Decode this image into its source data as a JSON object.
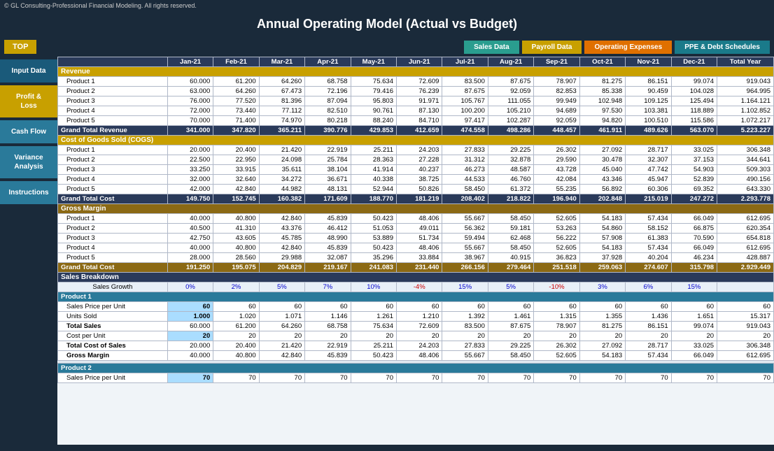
{
  "app": {
    "copyright": "© GL Consulting-Professional Financial Modeling. All rights reserved.",
    "title": "Annual Operating Model (Actual vs Budget)"
  },
  "nav": {
    "top_btn": "TOP",
    "buttons": [
      "Sales Data",
      "Payroll Data",
      "Operating Expenses",
      "PPE & Debt Schedules"
    ]
  },
  "sidebar": {
    "items": [
      {
        "label": "Input Data"
      },
      {
        "label": "Profit & Loss"
      },
      {
        "label": "Cash Flow"
      },
      {
        "label": "Variance Analysis"
      },
      {
        "label": "Instructions"
      }
    ]
  },
  "table": {
    "columns": [
      "",
      "Jan-21",
      "Feb-21",
      "Mar-21",
      "Apr-21",
      "May-21",
      "Jun-21",
      "Jul-21",
      "Aug-21",
      "Sep-21",
      "Oct-21",
      "Nov-21",
      "Dec-21",
      "Total Year"
    ],
    "revenue": {
      "header": "Revenue",
      "rows": [
        [
          "Product 1",
          "60.000",
          "61.200",
          "64.260",
          "68.758",
          "75.634",
          "72.609",
          "83.500",
          "87.675",
          "78.907",
          "81.275",
          "86.151",
          "99.074",
          "919.043"
        ],
        [
          "Product 2",
          "63.000",
          "64.260",
          "67.473",
          "72.196",
          "79.416",
          "76.239",
          "87.675",
          "92.059",
          "82.853",
          "85.338",
          "90.459",
          "104.028",
          "964.995"
        ],
        [
          "Product 3",
          "76.000",
          "77.520",
          "81.396",
          "87.094",
          "95.803",
          "91.971",
          "105.767",
          "111.055",
          "99.949",
          "102.948",
          "109.125",
          "125.494",
          "1.164.121"
        ],
        [
          "Product 4",
          "72.000",
          "73.440",
          "77.112",
          "82.510",
          "90.761",
          "87.130",
          "100.200",
          "105.210",
          "94.689",
          "97.530",
          "103.381",
          "118.889",
          "1.102.852"
        ],
        [
          "Product 5",
          "70.000",
          "71.400",
          "74.970",
          "80.218",
          "88.240",
          "84.710",
          "97.417",
          "102.287",
          "92.059",
          "94.820",
          "100.510",
          "115.586",
          "1.072.217"
        ]
      ],
      "total": [
        "Grand Total Revenue",
        "341.000",
        "347.820",
        "365.211",
        "390.776",
        "429.853",
        "412.659",
        "474.558",
        "498.286",
        "448.457",
        "461.911",
        "489.626",
        "563.070",
        "5.223.227"
      ]
    },
    "cogs": {
      "header": "Cost of Goods Sold (COGS)",
      "rows": [
        [
          "Product 1",
          "20.000",
          "20.400",
          "21.420",
          "22.919",
          "25.211",
          "24.203",
          "27.833",
          "29.225",
          "26.302",
          "27.092",
          "28.717",
          "33.025",
          "306.348"
        ],
        [
          "Product 2",
          "22.500",
          "22.950",
          "24.098",
          "25.784",
          "28.363",
          "27.228",
          "31.312",
          "32.878",
          "29.590",
          "30.478",
          "32.307",
          "37.153",
          "344.641"
        ],
        [
          "Product 3",
          "33.250",
          "33.915",
          "35.611",
          "38.104",
          "41.914",
          "40.237",
          "46.273",
          "48.587",
          "43.728",
          "45.040",
          "47.742",
          "54.903",
          "509.303"
        ],
        [
          "Product 4",
          "32.000",
          "32.640",
          "34.272",
          "36.671",
          "40.338",
          "38.725",
          "44.533",
          "46.760",
          "42.084",
          "43.346",
          "45.947",
          "52.839",
          "490.156"
        ],
        [
          "Product 5",
          "42.000",
          "42.840",
          "44.982",
          "48.131",
          "52.944",
          "50.826",
          "58.450",
          "61.372",
          "55.235",
          "56.892",
          "60.306",
          "69.352",
          "643.330"
        ]
      ],
      "total": [
        "Grand Total Cost",
        "149.750",
        "152.745",
        "160.382",
        "171.609",
        "188.770",
        "181.219",
        "208.402",
        "218.822",
        "196.940",
        "202.848",
        "215.019",
        "247.272",
        "2.293.778"
      ]
    },
    "gross_margin": {
      "header": "Gross Margin",
      "rows": [
        [
          "Product 1",
          "40.000",
          "40.800",
          "42.840",
          "45.839",
          "50.423",
          "48.406",
          "55.667",
          "58.450",
          "52.605",
          "54.183",
          "57.434",
          "66.049",
          "612.695"
        ],
        [
          "Product 2",
          "40.500",
          "41.310",
          "43.376",
          "46.412",
          "51.053",
          "49.011",
          "56.362",
          "59.181",
          "53.263",
          "54.860",
          "58.152",
          "66.875",
          "620.354"
        ],
        [
          "Product 3",
          "42.750",
          "43.605",
          "45.785",
          "48.990",
          "53.889",
          "51.734",
          "59.494",
          "62.468",
          "56.222",
          "57.908",
          "61.383",
          "70.590",
          "654.818"
        ],
        [
          "Product 4",
          "40.000",
          "40.800",
          "42.840",
          "45.839",
          "50.423",
          "48.406",
          "55.667",
          "58.450",
          "52.605",
          "54.183",
          "57.434",
          "66.049",
          "612.695"
        ],
        [
          "Product 5",
          "28.000",
          "28.560",
          "29.988",
          "32.087",
          "35.296",
          "33.884",
          "38.967",
          "40.915",
          "36.823",
          "37.928",
          "40.204",
          "46.234",
          "428.887"
        ]
      ],
      "total": [
        "Grand Total Cost",
        "191.250",
        "195.075",
        "204.829",
        "219.167",
        "241.083",
        "231.440",
        "266.156",
        "279.464",
        "251.518",
        "259.063",
        "274.607",
        "315.798",
        "2.929.449"
      ]
    },
    "breakdown": {
      "header": "Sales Breakdown",
      "growth_row": [
        "Sales Growth",
        "0%",
        "2%",
        "5%",
        "7%",
        "10%",
        "-4%",
        "15%",
        "5%",
        "-10%",
        "3%",
        "6%",
        "15%"
      ],
      "product1": {
        "header": "Product 1",
        "rows": [
          {
            "label": "Sales Price per Unit",
            "highlight": "60",
            "vals": [
              "60",
              "60",
              "60",
              "60",
              "60",
              "60",
              "60",
              "60",
              "60",
              "60",
              "60",
              "60"
            ]
          },
          {
            "label": "Units Sold",
            "highlight": "1.000",
            "vals": [
              "1.020",
              "1.071",
              "1.146",
              "1.261",
              "1.210",
              "1.392",
              "1.461",
              "1.315",
              "1.355",
              "1.436",
              "1.651",
              "15.317"
            ]
          },
          {
            "label": "Total Sales",
            "vals": [
              "60.000",
              "61.200",
              "64.260",
              "68.758",
              "75.634",
              "72.609",
              "83.500",
              "87.675",
              "78.907",
              "81.275",
              "86.151",
              "99.074",
              "919.043"
            ]
          },
          {
            "label": "Cost per Unit",
            "highlight": "20",
            "vals": [
              "20",
              "20",
              "20",
              "20",
              "20",
              "20",
              "20",
              "20",
              "20",
              "20",
              "20",
              "20"
            ]
          },
          {
            "label": "Total Cost of Sales",
            "vals": [
              "20.000",
              "20.400",
              "21.420",
              "22.919",
              "25.211",
              "24.203",
              "27.833",
              "29.225",
              "26.302",
              "27.092",
              "28.717",
              "33.025",
              "306.348"
            ]
          },
          {
            "label": "Gross Margin",
            "vals": [
              "40.000",
              "40.800",
              "42.840",
              "45.839",
              "50.423",
              "48.406",
              "55.667",
              "58.450",
              "52.605",
              "54.183",
              "57.434",
              "66.049",
              "612.695"
            ]
          }
        ]
      },
      "product2": {
        "header": "Product 2",
        "rows": [
          {
            "label": "Sales Price per Unit",
            "highlight": "70",
            "vals": [
              "70",
              "70",
              "70",
              "70",
              "70",
              "70",
              "70",
              "70",
              "70",
              "70",
              "70",
              "70"
            ]
          }
        ]
      }
    }
  }
}
